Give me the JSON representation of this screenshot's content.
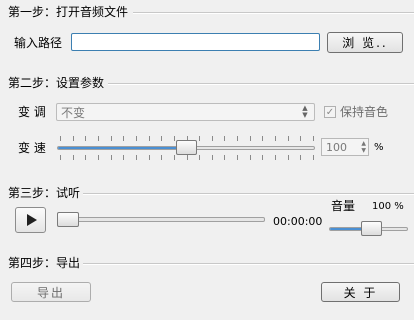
{
  "step1": {
    "title": "第一步：打开音频文件",
    "path_label": "输入路径",
    "path_value": "",
    "browse_label": "浏 览.."
  },
  "step2": {
    "title": "第二步：设置参数",
    "pitch_label": "变 调",
    "pitch_selected": "不变",
    "keep_pitch_label": "保持音色",
    "keep_pitch_checked": true,
    "speed_label": "变 速",
    "speed_value": "100",
    "speed_unit": "%",
    "speed_fraction": 0.5
  },
  "step3": {
    "title": "第三步：试听",
    "time": "00:00:00",
    "volume_label": "音量",
    "volume_value": "100 %",
    "progress_fraction": 0.0,
    "volume_fraction": 0.55
  },
  "step4": {
    "title": "第四步：导出",
    "export_label": "导出",
    "about_label": "关 于"
  },
  "colors": {
    "accent": "#4a8fd3",
    "input_border": "#3c7fb1",
    "background": "#f0f0f0"
  }
}
